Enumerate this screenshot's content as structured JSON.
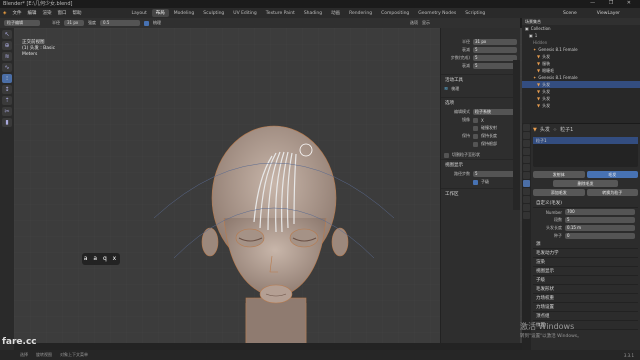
{
  "title": "Blender* [E:\\几何少女.blend]",
  "win_controls": "— ❐ ✕",
  "menu": [
    "文件",
    "编辑",
    "渲染",
    "窗口",
    "帮助"
  ],
  "workspaces": [
    {
      "label": "Layout"
    },
    {
      "label": "布局"
    },
    {
      "label": "Modeling"
    },
    {
      "label": "Sculpting"
    },
    {
      "label": "UV Editing"
    },
    {
      "label": "Texture Paint"
    },
    {
      "label": "Shading"
    },
    {
      "label": "动画"
    },
    {
      "label": "Rendering"
    },
    {
      "label": "Compositing"
    },
    {
      "label": "Geometry Nodes"
    },
    {
      "label": "Scripting"
    }
  ],
  "active_workspace": "Layout",
  "scene": "Scene",
  "view_layer": "ViewLayer",
  "tool_header": {
    "mode": "粒子编辑",
    "radius_label": "半径",
    "radius": "31 px",
    "strength_label": "强度",
    "strength": "0.5",
    "mode_label": "梳理",
    "options": [
      "选项",
      "显示"
    ]
  },
  "viewport_info": {
    "view": "正交前视图",
    "object": "(1) 头发 : Basic",
    "units": "Meters"
  },
  "keys": "a a q x",
  "npanel": {
    "radius_label": "半径",
    "radius": "31 px",
    "falloff_label": "衰减",
    "falloff": "5",
    "steps_label": "步数(完成)",
    "steps": "5",
    "strength_label": "衰减",
    "strength": "5",
    "tool_section": "活动工具",
    "comb": "梳理",
    "options_section": "选项",
    "mode_label": "编辑模式",
    "mode_value": "粒子系统",
    "mirror_label": "镜像",
    "mirror": "X",
    "deflect_label": "",
    "deflect_emitter": "碰撞发射",
    "preserve_label": "保持",
    "preserve_length": "保持长度",
    "preserve_root": "保持根部",
    "cut_label": "切割粒子至形状",
    "viewport_display": "视图显示",
    "path_steps_label": "路径步数",
    "path_steps": "5",
    "children": "子级",
    "workspace": "工作区"
  },
  "outliner": {
    "title": "场景集合",
    "items": [
      "Collection",
      "1",
      "Hidden",
      "Genesis 8.1 Female",
      "头发",
      "服装",
      "眼睫毛",
      "Genesis 8.1 Female",
      "头发",
      "头发",
      "头发",
      "头发"
    ]
  },
  "props": {
    "object": "头发",
    "system": "粒子1",
    "tab_hair": "毛发",
    "tab_emitter": "发射体",
    "add": "添加毛发",
    "convert": "转换为粒子",
    "delete": "删除毛发",
    "sections": [
      "自定义(毛发)",
      "源",
      "毛发动力学",
      "渲染",
      "视图显示",
      "子级",
      "毛发形状",
      "力场权重",
      "力场设置",
      "顶点组",
      "纹理",
      "自定义属性"
    ],
    "fields": [
      {
        "label": "Number",
        "value": "700"
      },
      {
        "label": "段数",
        "value": "5"
      },
      {
        "label": "头发长度",
        "value": "0.15 m"
      },
      {
        "label": "种子",
        "value": "0"
      }
    ]
  },
  "status": {
    "left": "选择",
    "middle": "旋转视图",
    "right": "对象上下文菜单",
    "version": "3.3.1"
  },
  "watermark_title": "激活 Windows",
  "watermark_sub": "转到\"设置\"以激活 Windows。",
  "logo": "fare.cc"
}
